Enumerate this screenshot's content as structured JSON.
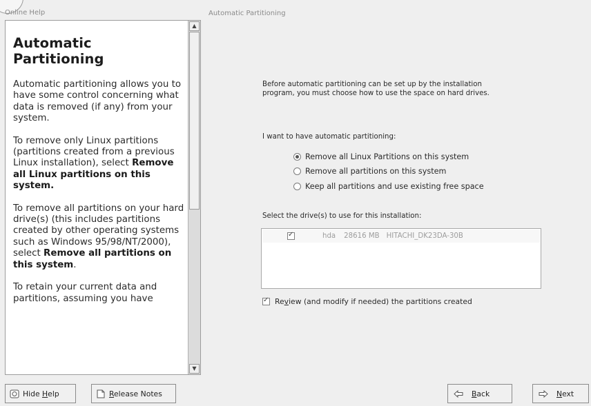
{
  "window": {
    "help_title": "Online Help",
    "main_title": "Automatic Partitioning"
  },
  "help": {
    "heading": "Automatic Partitioning",
    "para1": "Automatic partitioning allows you to have some control concerning what data is removed (if any) from your system.",
    "para2_text": "To remove only Linux partitions (partitions created from a previous Linux installation), select ",
    "para2_bold": "Remove all Linux partitions on this system.",
    "para3_text": "To remove all partitions on your hard drive(s) (this includes partitions created by other operating systems such as Windows 95/98/NT/2000), select ",
    "para3_bold": "Remove all partitions on this system",
    "para3_end": ".",
    "para4": "To retain your current data and partitions, assuming you have"
  },
  "main": {
    "intro": "Before automatic partitioning can be set up by the installation program, you must choose how to use the space on hard drives.",
    "question": "I want to have automatic partitioning:",
    "options": [
      {
        "label": "Remove all Linux Partitions on this system",
        "selected": true
      },
      {
        "label": "Remove all partitions on this system",
        "selected": false
      },
      {
        "label": "Keep all partitions and use existing free space",
        "selected": false
      }
    ],
    "drive_label": "Select the drive(s) to use for this installation:",
    "drives": [
      {
        "checked": true,
        "device": "hda",
        "size": "28616 MB",
        "model": "HITACHI_DK23DA-30B"
      }
    ],
    "review": {
      "checked": true,
      "pre": "Re",
      "mnemonic": "v",
      "post": "iew (and modify if needed) the partitions created"
    }
  },
  "buttons": {
    "hide_help": {
      "pre": "Hide ",
      "mnemonic": "H",
      "post": "elp"
    },
    "release_notes": {
      "pre": "",
      "mnemonic": "R",
      "post": "elease Notes"
    },
    "back": {
      "pre": "",
      "mnemonic": "B",
      "post": "ack"
    },
    "next": {
      "pre": "",
      "mnemonic": "N",
      "post": "ext"
    }
  },
  "icons": {
    "hide_help": "help-book-icon",
    "release_notes": "document-icon",
    "back": "back-arrow-icon",
    "next": "next-arrow-icon"
  }
}
